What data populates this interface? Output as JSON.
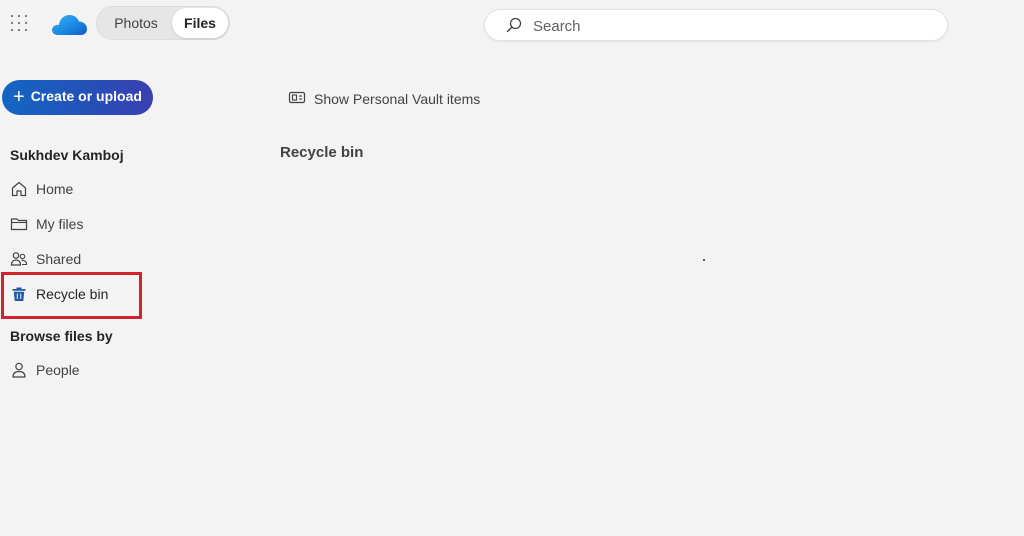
{
  "app": {
    "waffle_icon": "app-launcher-icon",
    "logo_icon": "onedrive-cloud-icon",
    "accent_color": "#0f6cbd",
    "highlight_color": "#d2232a"
  },
  "header": {
    "pivot": [
      {
        "label": "Photos",
        "selected": false
      },
      {
        "label": "Files",
        "selected": true
      }
    ],
    "search": {
      "placeholder": "Search",
      "value": "",
      "icon": "search-icon"
    }
  },
  "sidebar": {
    "create_button": {
      "label": "Create or upload",
      "icon": "plus-icon"
    },
    "account_title": "Sukhdev Kamboj",
    "items": [
      {
        "label": "Home",
        "icon": "home-icon"
      },
      {
        "label": "My files",
        "icon": "folder-icon"
      },
      {
        "label": "Shared",
        "icon": "people-shared-icon"
      },
      {
        "label": "Recycle bin",
        "icon": "recycle-bin-icon",
        "active": true
      }
    ],
    "browse_title": "Browse files by",
    "browse_items": [
      {
        "label": "People",
        "icon": "person-icon"
      }
    ]
  },
  "main": {
    "vault_toggle": {
      "label": "Show Personal Vault items",
      "icon": "vault-icon"
    },
    "title": "Recycle bin"
  }
}
